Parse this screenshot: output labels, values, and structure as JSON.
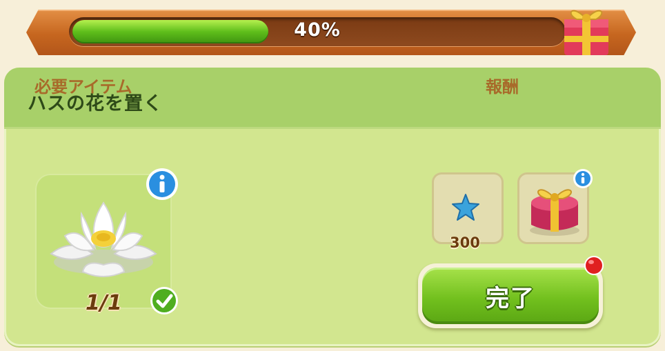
{
  "progress": {
    "percent_label": "40%",
    "fraction": 0.4
  },
  "task": {
    "title": "ハスの花を置く"
  },
  "required": {
    "label": "必要アイテム",
    "item_icon": "white-lotus-icon",
    "count": "1/1",
    "status_icon": "checkmark-icon"
  },
  "rewards": {
    "label": "報酬",
    "items": [
      {
        "icon": "blue-star-icon",
        "amount": "300"
      },
      {
        "icon": "gift-box-icon",
        "amount": ""
      }
    ]
  },
  "complete_button": {
    "label": "完了"
  },
  "colors": {
    "panel": "#d2e68f",
    "header": "#a8d069",
    "progress_frame": "#c6661f",
    "progress_fill": "#5fbe1b",
    "button": "#72c01e",
    "notify": "#e02020"
  }
}
